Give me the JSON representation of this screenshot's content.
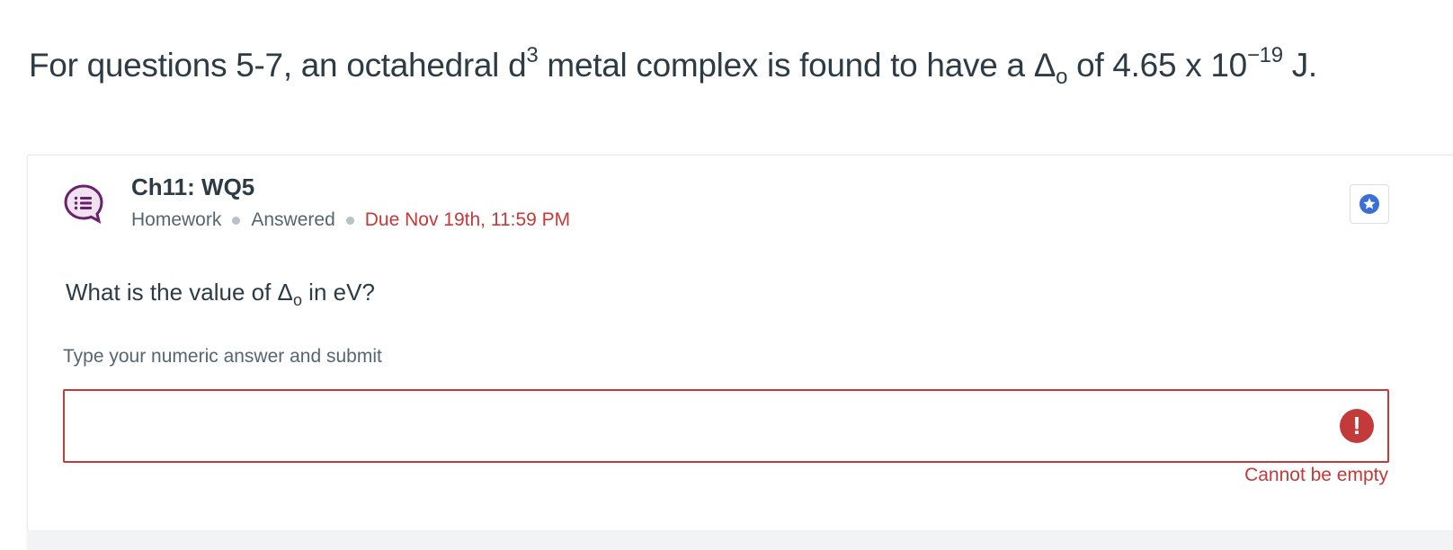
{
  "intro": {
    "prefix": "For questions 5-7, an octahedral d",
    "d_superscript": "3",
    "middle": " metal complex is found to have a Δ",
    "delta_subscript": "o",
    "value_text": " of 4.65 x 10",
    "exponent": "−19",
    "unit": " J."
  },
  "question": {
    "title": "Ch11: WQ5",
    "type": "Homework",
    "status": "Answered",
    "due": "Due Nov 19th, 11:59 PM",
    "prompt_prefix": "What is the value of Δ",
    "prompt_subscript": "o",
    "prompt_suffix": " in eV?",
    "hint": "Type your numeric answer and submit",
    "answer_value": "",
    "error_message": "Cannot be empty",
    "error_glyph": "!"
  },
  "colors": {
    "text": "#2d3b45",
    "muted": "#556572",
    "error": "#c33a3a",
    "question_icon": "#6b1f6e",
    "star_button": "#3b6fd8"
  },
  "icons": {
    "question_icon": "speech-bubble-list-icon",
    "star_icon": "star-badge-icon",
    "error_icon": "exclamation-icon"
  }
}
